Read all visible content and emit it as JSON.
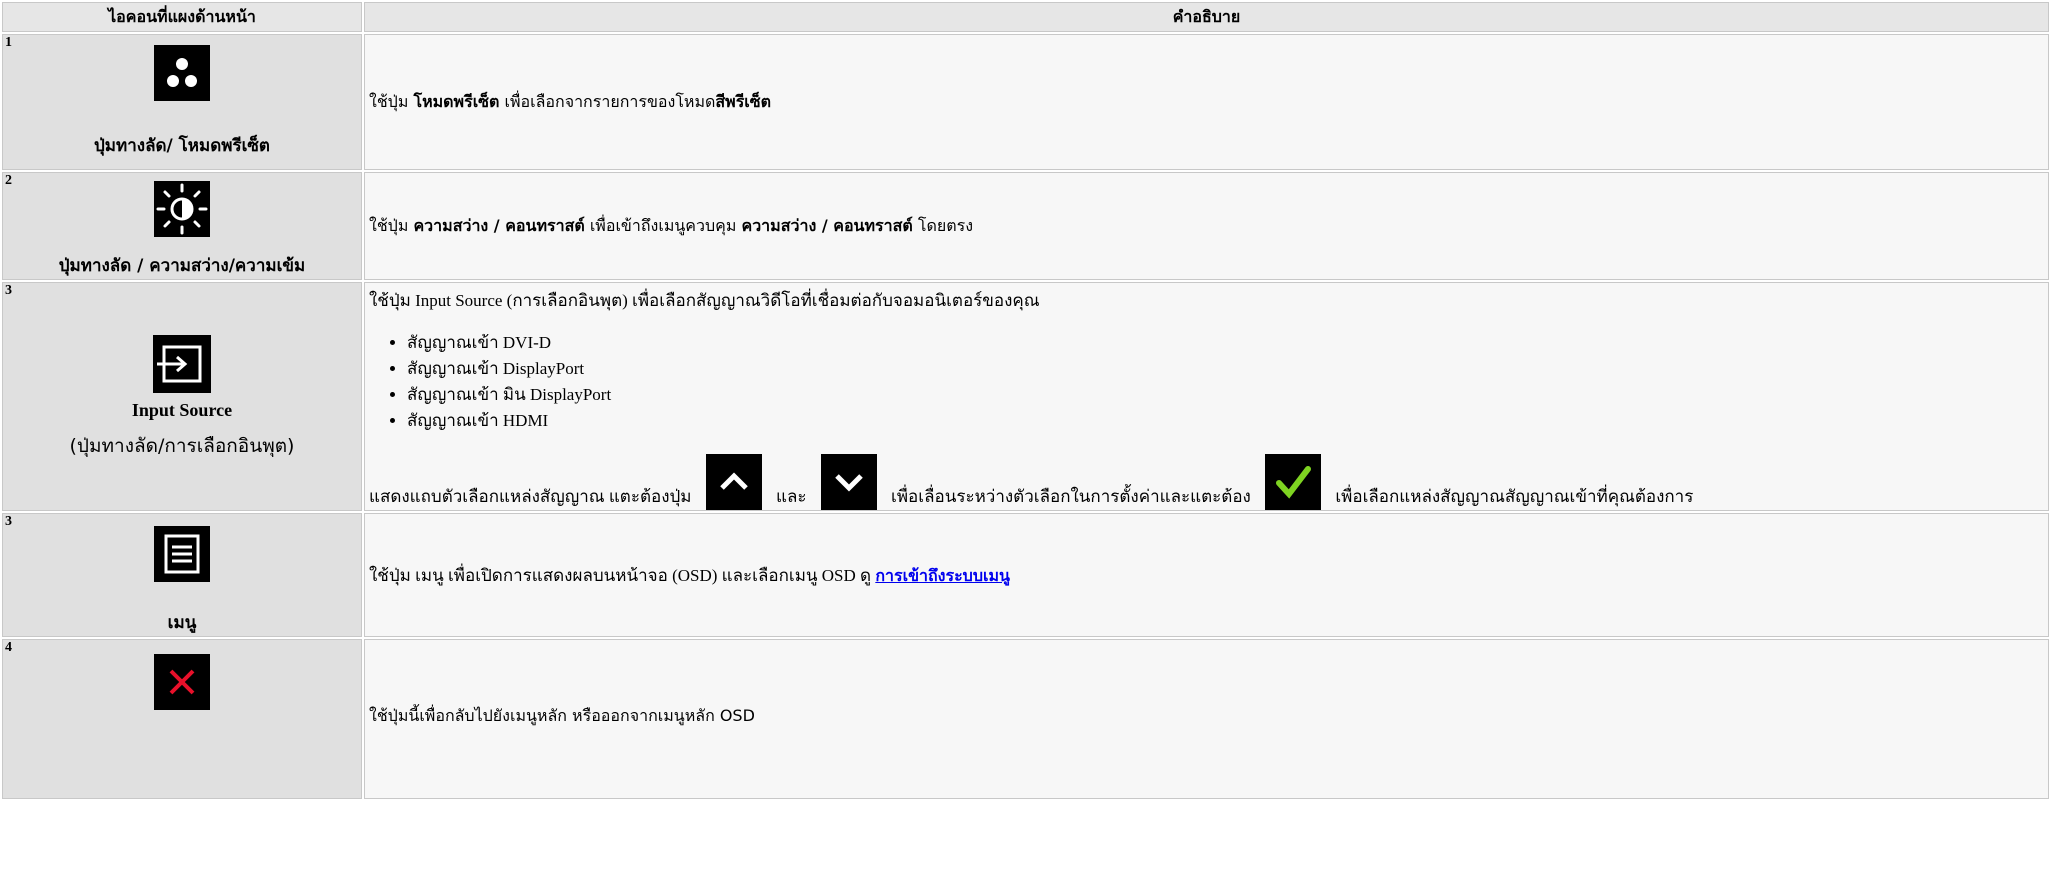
{
  "table": {
    "header_icon": "ไอคอนที่แผงด้านหน้า",
    "header_desc": "คำอธิบาย"
  },
  "rows": [
    {
      "num": "1",
      "icon": "preset-modes-icon",
      "caption": "ปุ่มทางลัด/ โหมดพรีเซ็ต",
      "desc": {
        "t1": "ใช้ปุ่ม ",
        "b1": "โหมดพรีเซ็ต",
        "t2": " เพื่อเลือกจากรายการของโหมด",
        "b2": "สีพรีเซ็ต"
      }
    },
    {
      "num": "2",
      "icon": "brightness-contrast-icon",
      "caption": "ปุ่มทางลัด / ความสว่าง/ความเข้ม",
      "desc": {
        "t1": "ใช้ปุ่ม ",
        "b1": "ความสว่าง / คอนทราสต์",
        "t2": " เพื่อเข้าถึงเมนูควบคุม ",
        "b2": "ความสว่าง / คอนทราสต์",
        "t3": " โดยตรง"
      }
    },
    {
      "num": "3",
      "icon": "input-source-icon",
      "caption_bold": "Input Source",
      "caption": "(ปุ่มทางลัด/การเลือกอินพุต)",
      "desc": {
        "intro": "ใช้ปุ่ม Input Source (การเลือกอินพุต) เพื่อเลือกสัญญาณวิดีโอที่เชื่อมต่อกับจอมอนิเตอร์ของคุณ",
        "items": [
          "สัญญาณเข้า DVI-D",
          "สัญญาณเข้า DisplayPort",
          "สัญญาณเข้า มิน DisplayPort",
          "สัญญาณเข้า HDMI"
        ],
        "outro1": "แสดงแถบตัวเลือกแหล่งสัญญาณ แตะต้องปุ่ม",
        "outro2": "และ",
        "outro3": "เพื่อเลื่อนระหว่างตัวเลือกในการตั้งค่าและแตะต้อง",
        "outro4": "เพื่อเลือกแหล่งสัญญาณสัญญาณเข้าที่คุณต้องการ"
      }
    },
    {
      "num": "3",
      "icon": "menu-icon",
      "caption": "เมนู",
      "desc": {
        "t1": "ใช้ปุ่ม เมนู เพื่อเปิดการแสดงผลบนหน้าจอ (OSD) และเลือกเมนู OSD ดู ",
        "link": "การเข้าถึงระบบเมนู"
      }
    },
    {
      "num": "4",
      "icon": "exit-icon",
      "caption": "",
      "desc": {
        "t1": "ใช้ปุ่มนี้เพื่อกลับไปยังเมนูหลัก หรือออกจากเมนูหลัก OSD"
      }
    }
  ],
  "colors": {
    "icon_bg": "#000000",
    "check_green": "#7ed321",
    "exit_red": "#e8102a",
    "link": "#0000ee"
  }
}
